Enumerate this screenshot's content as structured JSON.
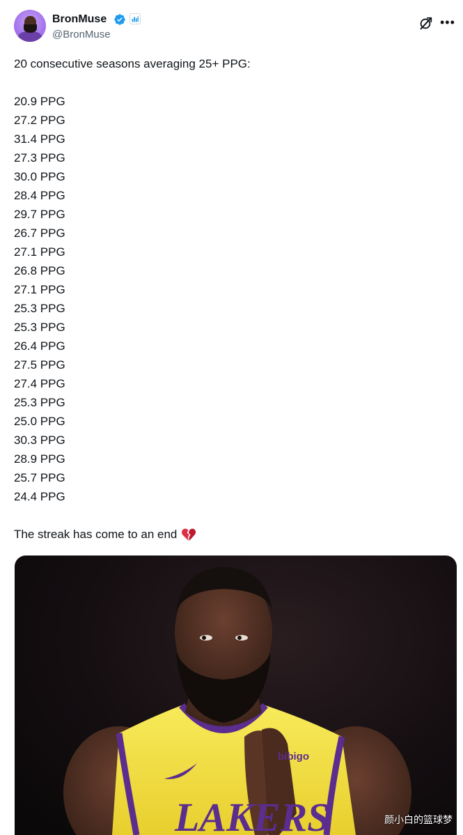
{
  "author": {
    "name": "BronMuse",
    "handle": "@BronMuse"
  },
  "icons": {
    "verified": "verified-badge-icon",
    "affiliate": "affiliate-badge-icon",
    "grok": "grok-icon",
    "more": "more-options-icon",
    "heart": "broken-heart-emoji"
  },
  "tweet": {
    "intro": "20 consecutive seasons averaging 25+ PPG:",
    "seasons": [
      "20.9 PPG",
      "27.2 PPG",
      "31.4 PPG",
      "27.3 PPG",
      "30.0 PPG",
      "28.4 PPG",
      "29.7 PPG",
      "26.7 PPG",
      "27.1 PPG",
      "26.8 PPG",
      "27.1 PPG",
      "25.3 PPG",
      "25.3 PPG",
      "26.4 PPG",
      "27.5 PPG",
      "27.4 PPG",
      "25.3 PPG",
      "25.0 PPG",
      "30.3 PPG",
      "28.9 PPG",
      "25.7 PPG",
      "24.4 PPG"
    ],
    "outro": "The streak has come to an end"
  },
  "media": {
    "watermark": "颜小白的篮球梦",
    "jersey_text": "LAKERS",
    "sponsor_text": "bibigo"
  },
  "colors": {
    "accent": "#1d9bf0",
    "jersey_yellow": "#f6e34a",
    "jersey_purple": "#5b2d8e",
    "secondary_text": "#536471"
  }
}
